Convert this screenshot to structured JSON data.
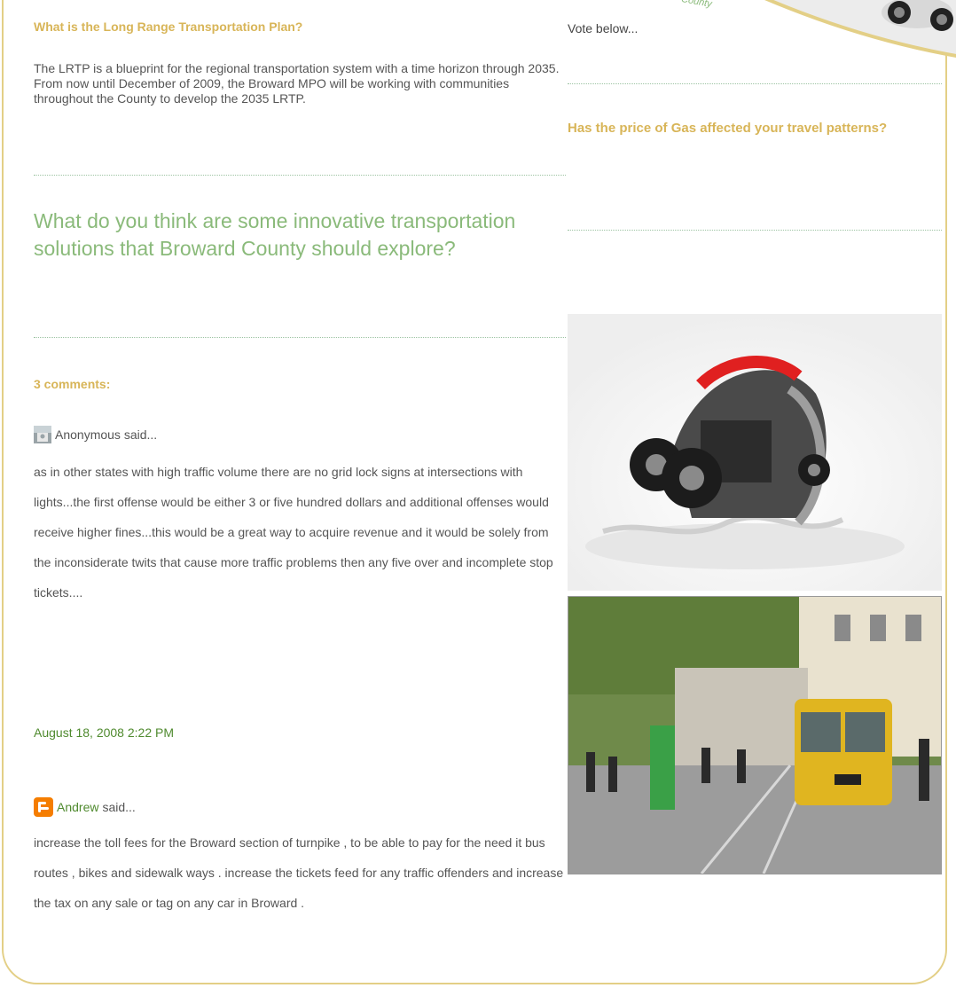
{
  "header": {
    "corner_caption": "County"
  },
  "post": {
    "question_title": "What is the Long Range Transportation Plan?",
    "intro": "The LRTP is a blueprint for the regional transportation system with a time horizon through 2035. From now until December of 2009, the Broward MPO will be working with communities throughout the County to develop the 2035 LRTP.",
    "big_question": "What do you think are some innovative transportation solutions that Broward County should explore?"
  },
  "comments": {
    "heading": "3 comments:",
    "items": [
      {
        "author": "Anonymous",
        "said": "said...",
        "body": "as in other states with high traffic volume there are no grid lock signs at intersections with lights...the first offense would be either 3 or five hundred dollars and additional offenses would receive higher fines...this would be a great way to acquire revenue and it would be solely from the inconsiderate twits that cause more traffic problems then any five over and incomplete stop tickets....",
        "timestamp": "August 18, 2008 2:22 PM",
        "icon": "anonymous-user-icon"
      },
      {
        "author": "Andrew",
        "said": "said...",
        "body": "increase the toll fees for the Broward section of turnpike , to be able to pay for the need it bus routes , bikes and sidewalk ways . increase the tickets feed for any traffic offenders and increase the tax on any sale or tag on any car in Broward .",
        "icon": "blogger-icon"
      }
    ]
  },
  "sidebar": {
    "vote_text": "Vote below...",
    "poll_question": "Has the price of Gas affected your travel patterns?"
  },
  "colors": {
    "gold": "#d8b558",
    "green": "#8aba7a",
    "link_green": "#4f8a2e",
    "frame": "#e3cf86"
  }
}
